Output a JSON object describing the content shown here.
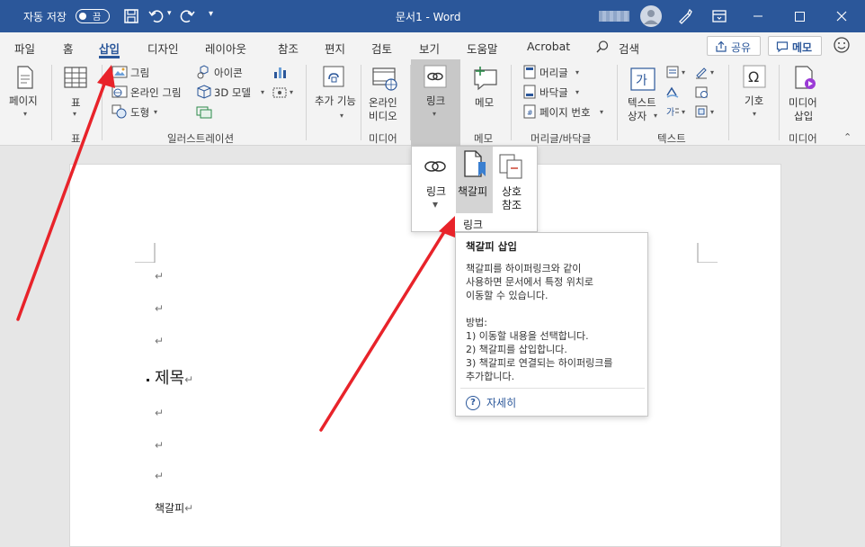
{
  "titlebar": {
    "autosave_label": "자동 저장",
    "toggle_state": "끔",
    "doc_title": "문서1 - Word"
  },
  "tabs": [
    "파일",
    "홈",
    "삽입",
    "디자인",
    "레이아웃",
    "참조",
    "편지",
    "검토",
    "보기",
    "도움말",
    "Acrobat"
  ],
  "active_tab": "삽입",
  "search_label": "검색",
  "share_label": "공유",
  "memo_label": "메모",
  "ribbon": {
    "page": "페이지",
    "table": "표",
    "picture": "그림",
    "online_picture": "온라인 그림",
    "shapes": "도형",
    "icons": "아이콘",
    "model3d": "3D 모델",
    "addins": "추가 기능",
    "online_video_1": "온라인",
    "online_video_2": "비디오",
    "link": "링크",
    "memo": "메모",
    "header": "머리글",
    "footer": "바닥글",
    "page_number": "페이지 번호",
    "textbox_1": "텍스트",
    "textbox_2": "상자",
    "symbol": "기호",
    "media_insert_1": "미디어",
    "media_insert_2": "삽입",
    "groups": {
      "table": "표",
      "illustration": "일러스트레이션",
      "media": "미디어",
      "memo": "메모",
      "header_footer": "머리글/바닥글",
      "text": "텍스트",
      "media2": "미디어"
    }
  },
  "dropdown": {
    "link": "링크",
    "bookmark": "책갈피",
    "crossref_1": "상호",
    "crossref_2": "참조",
    "group": "링크"
  },
  "tooltip": {
    "title": "책갈피 삽입",
    "desc_1": "책갈피를 하이퍼링크와 같이",
    "desc_2": "사용하면 문서에서 특정 위치로",
    "desc_3": "이동할 수 있습니다.",
    "method": "방법:",
    "step_1": "1) 이동할 내용을 선택합니다.",
    "step_2": "2) 책갈피를 삽입합니다.",
    "step_3": "3) 책갈피로 연결되는 하이퍼링크를",
    "step_3b": "추가합니다.",
    "more": "자세히"
  },
  "document": {
    "mark": "↵",
    "heading": "제목",
    "bookmark_text": "책갈피"
  }
}
